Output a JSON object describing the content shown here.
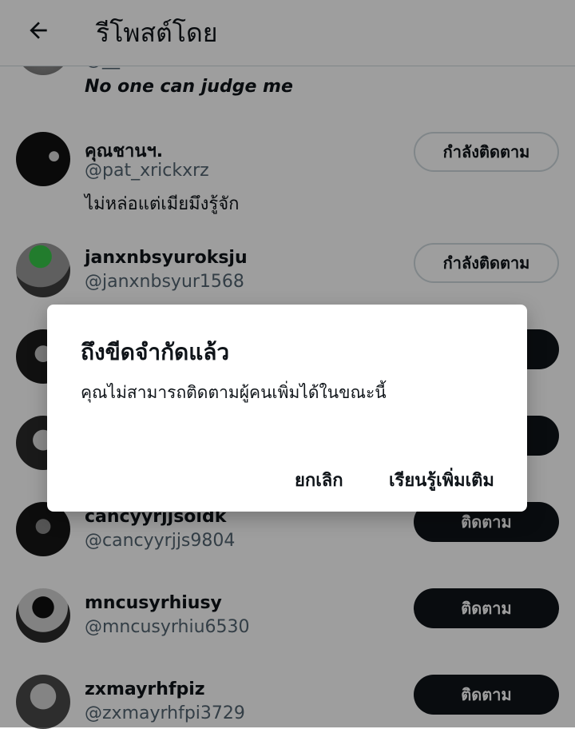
{
  "header": {
    "title": "รีโพสต์โดย",
    "back_icon": "arrow-left-icon"
  },
  "partial_row": {
    "bio": "No one can judge me"
  },
  "users": [
    {
      "name": "คุณชานฯ.",
      "handle": "@pat_xrickxrz",
      "bio": "ไม่หล่อแต่เมียมึงรู้จัก",
      "button": "กำลังติดตาม",
      "state": "following"
    },
    {
      "name": "janxnbsyuroksju",
      "handle": "@janxnbsyur1568",
      "bio": "",
      "button": "กำลังติดตาม",
      "state": "following"
    },
    {
      "name": "",
      "handle": "",
      "bio": "",
      "button": "",
      "state": "follow"
    },
    {
      "name": "",
      "handle": "",
      "bio": "",
      "button": "",
      "state": "follow"
    },
    {
      "name": "cancyyrjjsoidk",
      "handle": "@cancyyrjjs9804",
      "bio": "",
      "button": "ติดตาม",
      "state": "follow"
    },
    {
      "name": "mncusyrhiusy",
      "handle": "@mncusyrhiu6530",
      "bio": "",
      "button": "ติดตาม",
      "state": "follow"
    },
    {
      "name": "zxmayrhfpiz",
      "handle": "@zxmayrhfpi3729",
      "bio": "",
      "button": "ติดตาม",
      "state": "follow"
    }
  ],
  "dialog": {
    "title": "ถึงขีดจำกัดแล้ว",
    "message": "คุณไม่สามารถติดตามผู้คนเพิ่มได้ในขณะนี้",
    "cancel_label": "ยกเลิก",
    "learn_more_label": "เรียนรู้เพิ่มเติม"
  },
  "colors": {
    "text": "#0f1419",
    "secondary": "#536471",
    "border": "#cfd9de",
    "follow_bg": "#0f1419"
  }
}
